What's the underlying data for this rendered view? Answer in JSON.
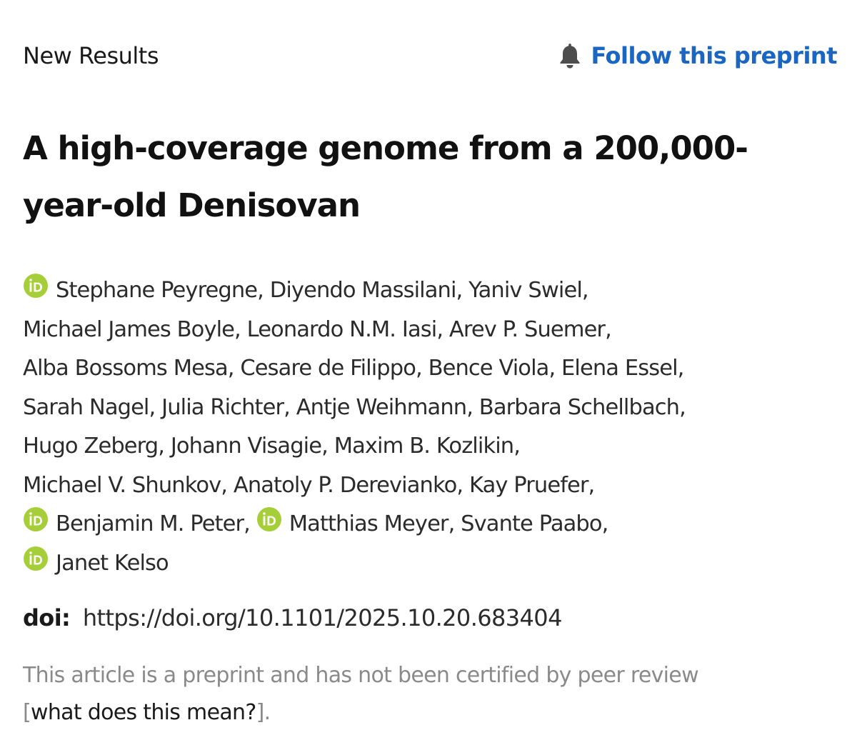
{
  "header": {
    "section_label": "New Results",
    "follow_label": "Follow this preprint",
    "follow_icon": "bell-icon"
  },
  "article": {
    "title": "A high-coverage genome from a 200,000-year-old Denisovan",
    "authors": [
      {
        "name": "Stephane Peyregne",
        "orcid": true
      },
      {
        "name": "Diyendo Massilani",
        "orcid": false
      },
      {
        "name": "Yaniv Swiel",
        "orcid": false
      },
      {
        "name": "Michael James Boyle",
        "orcid": false
      },
      {
        "name": "Leonardo N.M. Iasi",
        "orcid": false
      },
      {
        "name": "Arev P. Suemer",
        "orcid": false
      },
      {
        "name": "Alba Bossoms Mesa",
        "orcid": false
      },
      {
        "name": "Cesare de Filippo",
        "orcid": false
      },
      {
        "name": "Bence Viola",
        "orcid": false
      },
      {
        "name": "Elena Essel",
        "orcid": false
      },
      {
        "name": "Sarah Nagel",
        "orcid": false
      },
      {
        "name": "Julia Richter",
        "orcid": false
      },
      {
        "name": "Antje Weihmann",
        "orcid": false
      },
      {
        "name": "Barbara Schellbach",
        "orcid": false
      },
      {
        "name": "Hugo Zeberg",
        "orcid": false
      },
      {
        "name": "Johann Visagie",
        "orcid": false
      },
      {
        "name": "Maxim B. Kozlikin",
        "orcid": false
      },
      {
        "name": "Michael V. Shunkov",
        "orcid": false
      },
      {
        "name": "Anatoly P. Derevianko",
        "orcid": false
      },
      {
        "name": "Kay Pruefer",
        "orcid": false
      },
      {
        "name": "Benjamin M. Peter",
        "orcid": true
      },
      {
        "name": "Matthias Meyer",
        "orcid": true
      },
      {
        "name": "Svante Paabo",
        "orcid": false
      },
      {
        "name": "Janet Kelso",
        "orcid": true
      }
    ],
    "doi_label": "doi:",
    "doi_url": "https://doi.org/10.1101/2025.10.20.683404",
    "disclaimer": {
      "text": "This article is a preprint and has not been certified by peer review",
      "bracket_open": "[",
      "link_text": "what does this mean?",
      "bracket_close": "]."
    }
  },
  "colors": {
    "link_blue": "#1a66c2",
    "orcid_green": "#a6ce39",
    "muted_gray": "#8a8a8a"
  }
}
